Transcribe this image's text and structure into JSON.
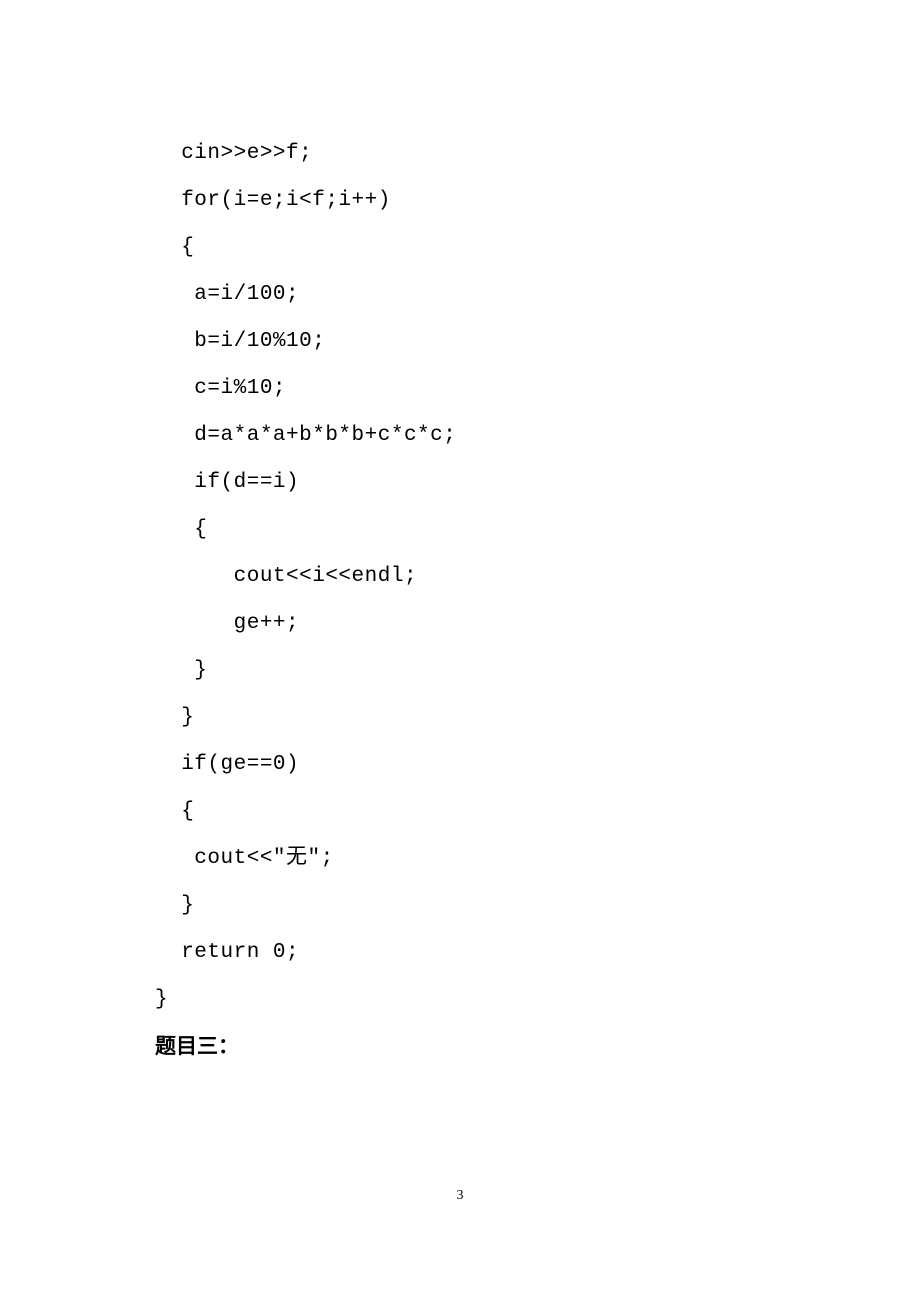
{
  "code": {
    "lines": [
      "  cin>>e>>f;",
      "  for(i=e;i<f;i++)",
      "  {",
      "   a=i/100;",
      "   b=i/10%10;",
      "   c=i%10;",
      "   d=a*a*a+b*b*b+c*c*c;",
      "   if(d==i)",
      "   {",
      "      cout<<i<<endl;",
      "      ge++;",
      "   }",
      "",
      "  }",
      "  if(ge==0)",
      "  {",
      "   cout<<\"无\";",
      "  }",
      "",
      "  return 0;",
      "}"
    ]
  },
  "heading": "题目三：",
  "page_number": "3"
}
